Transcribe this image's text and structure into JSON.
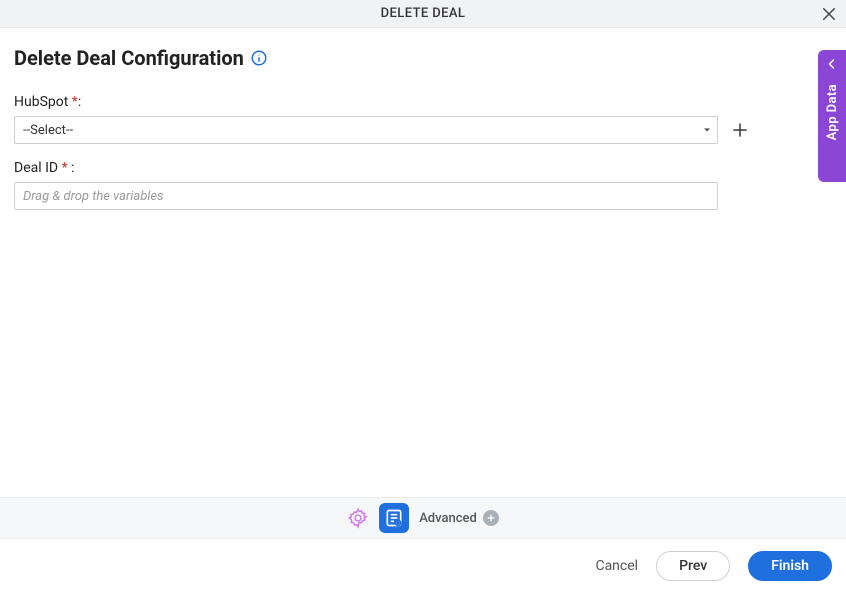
{
  "titlebar": {
    "title": "DELETE DEAL"
  },
  "header": {
    "title": "Delete Deal Configuration"
  },
  "sidepanel": {
    "label": "App Data"
  },
  "form": {
    "hubspot": {
      "label": "HubSpot",
      "required_marker": "*",
      "colon": ":",
      "placeholder_option": "--Select--"
    },
    "dealid": {
      "label": "Deal ID ",
      "required_marker": "*",
      "colon": " :",
      "placeholder": "Drag & drop the variables"
    }
  },
  "toolbar": {
    "advanced_label": "Advanced"
  },
  "footer": {
    "cancel": "Cancel",
    "prev": "Prev",
    "finish": "Finish"
  }
}
